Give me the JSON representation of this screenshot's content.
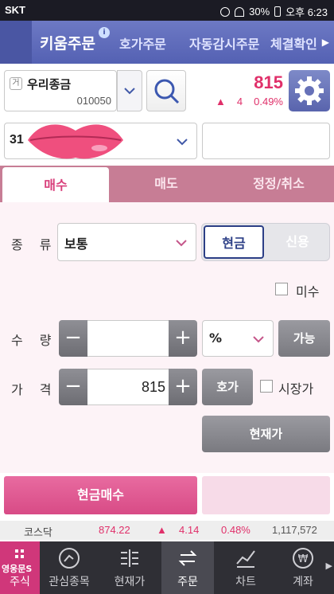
{
  "status": {
    "carrier": "SKT",
    "battery": "30%",
    "time": "오후 6:23"
  },
  "tabs": {
    "active": "키움주문",
    "t2": "호가주문",
    "t3": "자동감시주문",
    "t4": "체결확인"
  },
  "stock": {
    "market": "거",
    "name": "우리종금",
    "code": "010050",
    "price": "815",
    "change": "4",
    "rate": "0.49%"
  },
  "account": {
    "number": "31"
  },
  "order_tabs": {
    "buy": "매수",
    "sell": "매도",
    "modify": "정정/취소"
  },
  "form": {
    "type_label": "종 류",
    "type_value": "보통",
    "cash": "현금",
    "credit": "신용",
    "unfilled": "미수",
    "qty_label": "수 량",
    "unit": "%",
    "possible": "가능",
    "price_label": "가 격",
    "price_value": "815",
    "hoga": "호가",
    "market_price": "시장가",
    "current_price": "현재가",
    "submit": "현금매수"
  },
  "ticker": {
    "name": "코스닥",
    "value": "874.22",
    "change": "4.14",
    "rate": "0.48%",
    "volume": "1,117,572"
  },
  "nav": {
    "logo": "영웅문S",
    "home": "주식",
    "watch": "관심종목",
    "current": "현재가",
    "order": "주문",
    "chart": "차트",
    "account": "계좌"
  },
  "colors": {
    "accent": "#d83f7b",
    "brand": "#5a66b5"
  }
}
